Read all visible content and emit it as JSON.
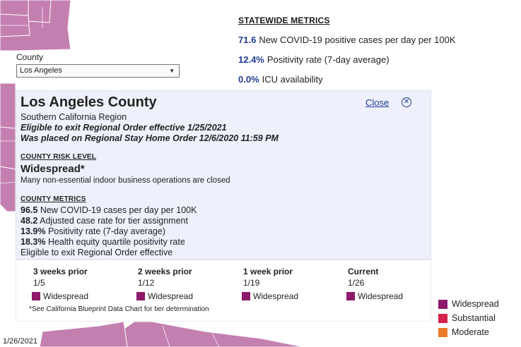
{
  "statewide": {
    "title": "STATEWIDE METRICS",
    "metrics": [
      {
        "value": "71.6",
        "label": "New COVID-19 positive cases per day per 100K"
      },
      {
        "value": "12.4%",
        "label": "Positivity rate (7-day average)"
      },
      {
        "value": "0.0%",
        "label": "ICU availability"
      }
    ]
  },
  "county_selector": {
    "label": "County",
    "selected": "Los Angeles"
  },
  "county": {
    "name": "Los Angeles County",
    "region": "Southern California Region",
    "eligible": "Eligible to exit Regional Order effective 1/25/2021",
    "placed": "Was placed on Regional Stay Home Order 12/6/2020 11:59 PM",
    "close_label": "Close",
    "risk_heading": "COUNTY RISK LEVEL",
    "risk_level": "Widespread*",
    "risk_desc": "Many non-essential indoor business operations are closed",
    "metrics_heading": "COUNTY METRICS",
    "metrics": [
      {
        "value": "96.5",
        "label": "New COVID-19 cases per day per 100K"
      },
      {
        "value": "48.2",
        "label": "Adjusted case rate for tier assignment"
      },
      {
        "value": "13.9%",
        "label": "Positivity rate (7-day average)"
      },
      {
        "value": "18.3%",
        "label": "Health equity quartile positivity rate"
      }
    ],
    "metrics_note": "Eligible to exit Regional Order effective"
  },
  "history": {
    "columns": [
      {
        "label": "3 weeks prior",
        "date": "1/5",
        "tier": "Widespread"
      },
      {
        "label": "2 weeks prior",
        "date": "1/12",
        "tier": "Widespread"
      },
      {
        "label": "1 week prior",
        "date": "1/19",
        "tier": "Widespread"
      },
      {
        "label": "Current",
        "date": "1/26",
        "tier": "Widespread"
      }
    ],
    "footnote": "*See California Blueprint Data Chart for tier determination"
  },
  "legend": [
    {
      "label": "Widespread",
      "color": "#8e1a6b"
    },
    {
      "label": "Substantial",
      "color": "#d8224b"
    },
    {
      "label": "Moderate",
      "color": "#ea7a2a"
    }
  ],
  "colors": {
    "widespread_map": "#c47fb1",
    "accent": "#1f3b8f",
    "card_bg": "#eef0fb"
  },
  "date_stamp": "1/26/2021"
}
